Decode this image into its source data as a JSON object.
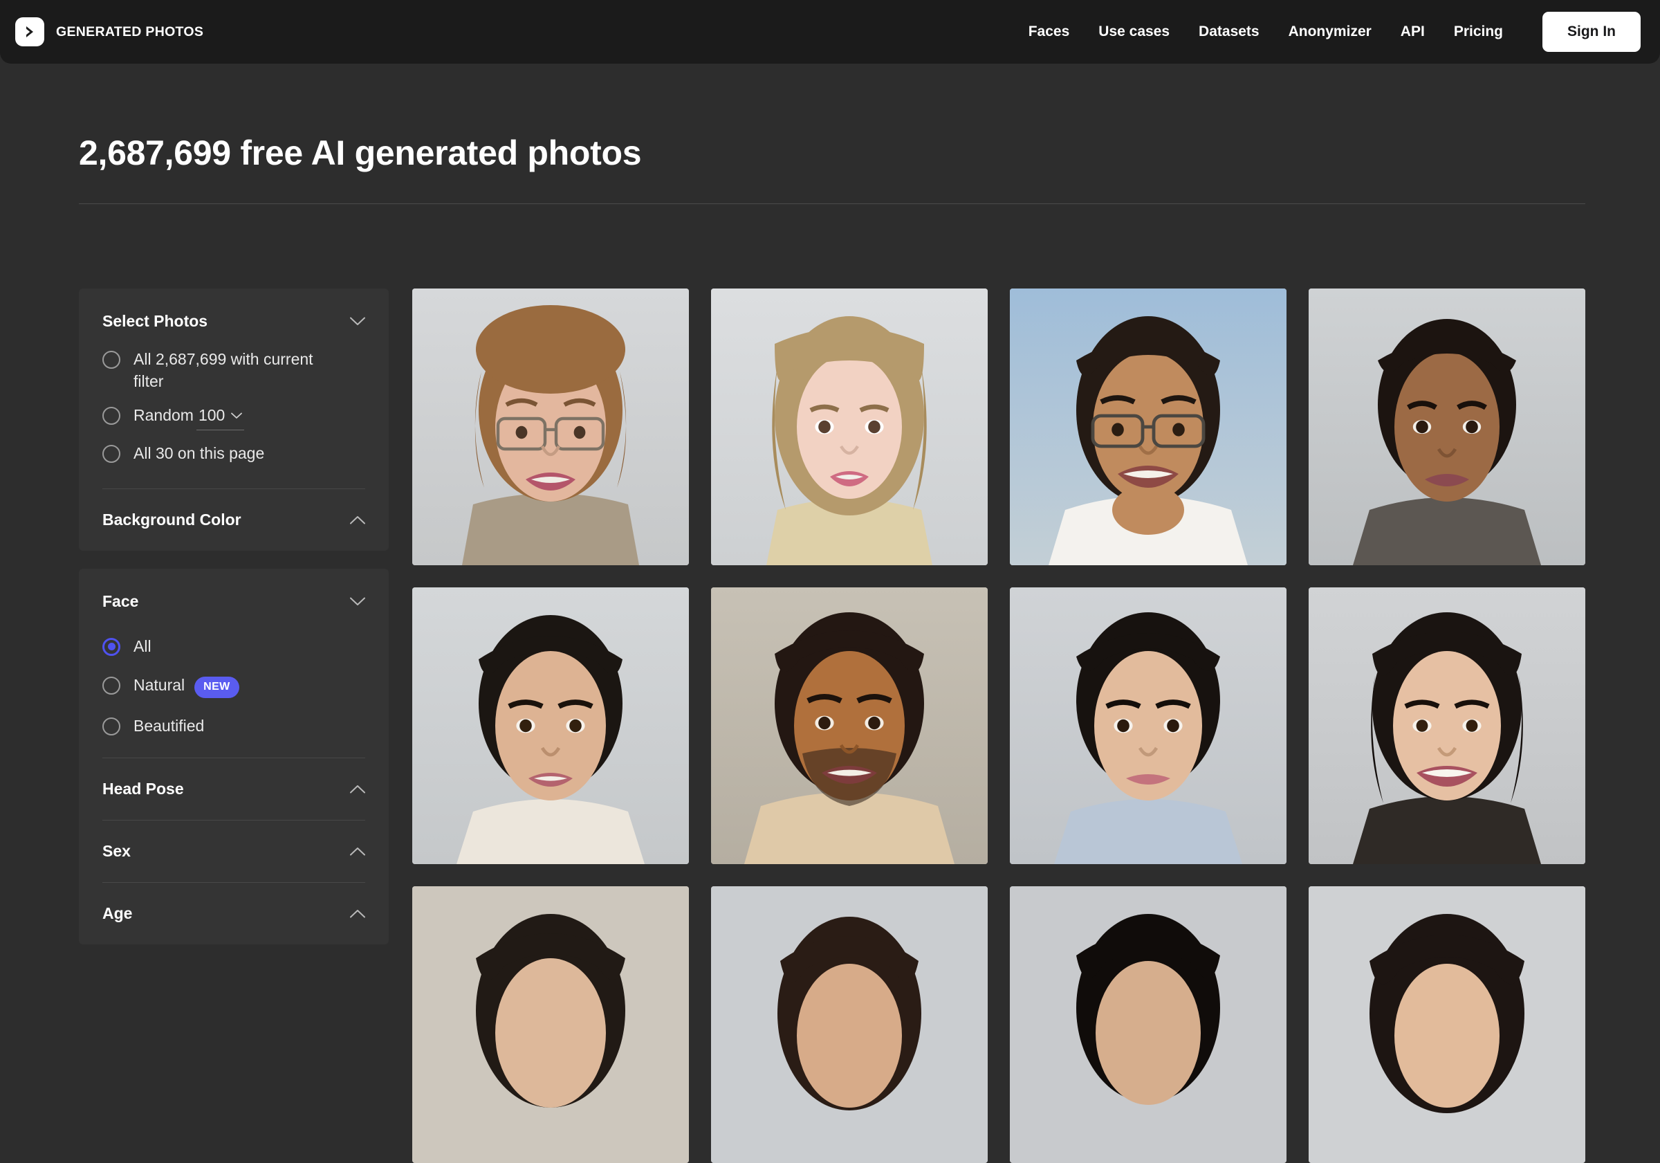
{
  "header": {
    "logo_icon": "chevron-right-logo-icon",
    "brand_name": "GENERATED PHOTOS",
    "nav": [
      {
        "label": "Faces"
      },
      {
        "label": "Use cases"
      },
      {
        "label": "Datasets"
      },
      {
        "label": "Anonymizer"
      },
      {
        "label": "API"
      },
      {
        "label": "Pricing"
      }
    ],
    "signin_label": "Sign In"
  },
  "main": {
    "page_title": "2,687,699 free AI generated photos"
  },
  "sidebar": {
    "panels": [
      {
        "sections": [
          {
            "title": "Select Photos",
            "chevron": "chevron-down-icon",
            "expanded": true,
            "options": [
              {
                "label": "All 2,687,699 with current filter",
                "selected": false
              },
              {
                "label": "Random",
                "selected": false,
                "select_value": "100",
                "select_chevron": "chevron-down-icon"
              },
              {
                "label": "All 30 on this page",
                "selected": false
              }
            ]
          },
          {
            "title": "Background Color",
            "chevron": "chevron-up-icon",
            "expanded": false
          }
        ]
      },
      {
        "sections": [
          {
            "title": "Face",
            "chevron": "chevron-down-icon",
            "expanded": true,
            "options": [
              {
                "label": "All",
                "selected": true
              },
              {
                "label": "Natural",
                "selected": false,
                "badge": "NEW"
              },
              {
                "label": "Beautified",
                "selected": false
              }
            ]
          },
          {
            "title": "Head Pose",
            "chevron": "chevron-up-icon",
            "expanded": false
          },
          {
            "title": "Sex",
            "chevron": "chevron-up-icon",
            "expanded": false
          },
          {
            "title": "Age",
            "chevron": "chevron-up-icon",
            "expanded": false
          }
        ]
      }
    ]
  },
  "colors": {
    "page_bg": "#2d2d2d",
    "header_bg": "#1b1b1b",
    "panel_bg": "#343434",
    "accent": "#4f52ef",
    "badge_new": "#5a5cf0",
    "text_primary": "#ffffff",
    "text_secondary": "#e9e9e9",
    "radio_border": "#9a9a9a",
    "divider": "#484848"
  },
  "gallery": {
    "items": [
      {
        "alt": "woman with glasses smiling",
        "bg": "#cfd1d2",
        "skin": "#e0b19a",
        "hair": "#9a6b3f",
        "shirt": "#a99b86",
        "row": 1
      },
      {
        "alt": "young girl blonde hair",
        "bg": "#d5d7d9",
        "skin": "#f0cdc0",
        "hair": "#b59a6c",
        "shirt": "#ded0a8",
        "row": 1
      },
      {
        "alt": "man with glasses smiling",
        "bg": "#aec4db",
        "skin": "#c08b5e",
        "hair": "#241a14",
        "shirt": "#f2f0ec",
        "row": 1
      },
      {
        "alt": "woman short dark hair",
        "bg": "#c6c9cc",
        "skin": "#9c6a45",
        "hair": "#1c1410",
        "shirt": "#5c5752",
        "row": 1
      },
      {
        "alt": "young man dark hair",
        "bg": "#cfd2d4",
        "skin": "#ddb393",
        "hair": "#1b1612",
        "shirt": "#e8e2d8",
        "row": 2
      },
      {
        "alt": "man with beard smiling",
        "bg": "#bfb9ae",
        "skin": "#b0703c",
        "hair": "#231712",
        "shirt": "#dfc9a8",
        "row": 2
      },
      {
        "alt": "young man neutral expression",
        "bg": "#c9cdd0",
        "skin": "#e2bb9c",
        "hair": "#17120f",
        "shirt": "#b9c6d6",
        "row": 2
      },
      {
        "alt": "woman smiling dark hair",
        "bg": "#c9cbcd",
        "skin": "#e6c0a3",
        "hair": "#1a1411",
        "shirt": "#2f2a26",
        "row": 2
      },
      {
        "alt": "person dark hair partial",
        "bg": "#cdc7bd",
        "skin": "#ddb89a",
        "hair": "#211a15",
        "shirt": "#3a3430",
        "row": 3
      },
      {
        "alt": "person curly hair partial",
        "bg": "#cacdd0",
        "skin": "#d7ab89",
        "hair": "#2a1c15",
        "shirt": "#3a3430",
        "row": 3
      },
      {
        "alt": "person black hair partial",
        "bg": "#c8cacd",
        "skin": "#d6ae8d",
        "hair": "#100c0a",
        "shirt": "#3a3430",
        "row": 3
      },
      {
        "alt": "person long dark hair partial",
        "bg": "#cfd1d3",
        "skin": "#e2bb9b",
        "hair": "#1d1512",
        "shirt": "#3a3430",
        "row": 3
      }
    ]
  }
}
